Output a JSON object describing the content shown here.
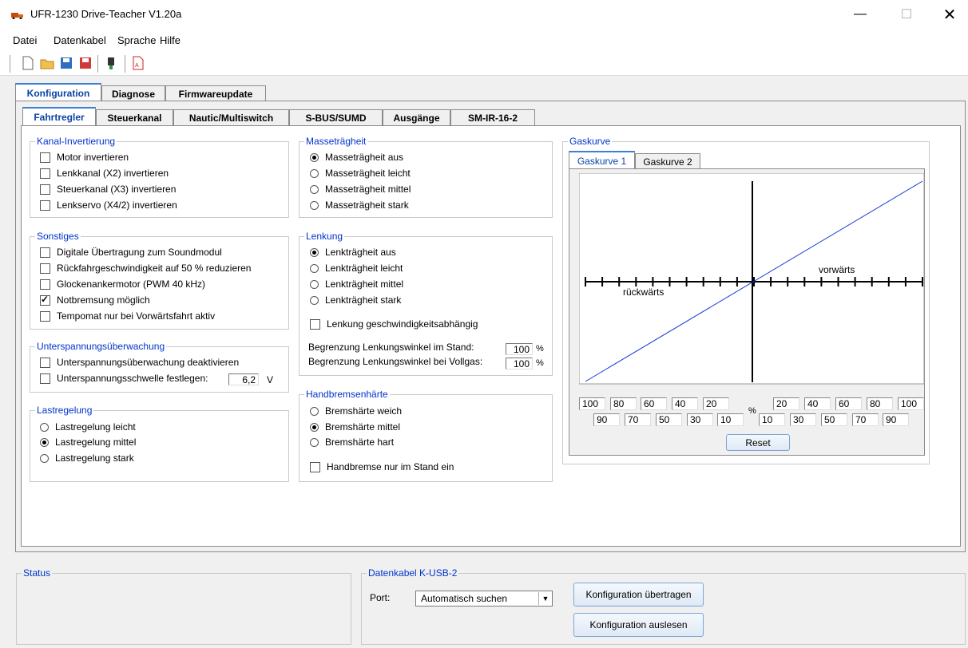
{
  "window": {
    "title": "UFR-1230 Drive-Teacher V1.20a"
  },
  "menu": {
    "datei": "Datei",
    "datenkabel": "Datenkabel",
    "sprache": "Sprache",
    "hilfe": "Hilfe"
  },
  "main_tabs": [
    "Konfiguration",
    "Diagnose",
    "Firmwareupdate"
  ],
  "sub_tabs": [
    "Fahrtregler",
    "Steuerkanal",
    "Nautic/Multiswitch",
    "S-BUS/SUMD",
    "Ausgänge",
    "SM-IR-16-2"
  ],
  "kanal": {
    "title": "Kanal-Invertierung",
    "items": [
      "Motor invertieren",
      "Lenkkanal (X2) invertieren",
      "Steuerkanal (X3) invertieren",
      "Lenkservo (X4/2) invertieren"
    ]
  },
  "sonstiges": {
    "title": "Sonstiges",
    "items": [
      "Digitale Übertragung zum Soundmodul",
      "Rückfahrgeschwindigkeit auf 50 % reduzieren",
      "Glockenankermotor (PWM 40 kHz)",
      "Notbremsung möglich",
      "Tempomat nur bei Vorwärtsfahrt aktiv"
    ]
  },
  "unterspannung": {
    "title": "Unterspannungsüberwachung",
    "deactivate": "Unterspannungsüberwachung deaktivieren",
    "threshold": "Unterspannungsschwelle festlegen:",
    "value": "6,2",
    "unit": "V"
  },
  "last": {
    "title": "Lastregelung",
    "items": [
      "Lastregelung leicht",
      "Lastregelung mittel",
      "Lastregelung stark"
    ]
  },
  "masse": {
    "title": "Masseträgheit",
    "items": [
      "Masseträgheit aus",
      "Masseträgheit leicht",
      "Masseträgheit mittel",
      "Masseträgheit stark"
    ]
  },
  "lenkung": {
    "title": "Lenkung",
    "items": [
      "Lenkträgheit aus",
      "Lenkträgheit leicht",
      "Lenkträgheit mittel",
      "Lenkträgheit stark"
    ],
    "speed_dep": "Lenkung geschwindigkeitsabhängig",
    "limit_stand_label": "Begrenzung Lenkungswinkel im Stand:",
    "limit_stand_value": "100",
    "limit_full_label": "Begrenzung Lenkungswinkel bei Vollgas:",
    "limit_full_value": "100",
    "pct": "%"
  },
  "handbremse": {
    "title": "Handbremsenhärte",
    "items": [
      "Bremshärte weich",
      "Bremshärte mittel",
      "Bremshärte hart"
    ],
    "stand": "Handbremse nur im Stand ein"
  },
  "gaskurve": {
    "title": "Gaskurve",
    "tabs": [
      "Gaskurve 1",
      "Gaskurve 2"
    ],
    "forward_label": "vorwärts",
    "reverse_label": "rückwärts",
    "left_top": [
      "100",
      "80",
      "60",
      "40",
      "20"
    ],
    "left_bottom": [
      "90",
      "70",
      "50",
      "30",
      "10"
    ],
    "right_top": [
      "20",
      "40",
      "60",
      "80",
      "100"
    ],
    "right_bottom": [
      "10",
      "30",
      "50",
      "70",
      "90"
    ],
    "pct": "%",
    "reset": "Reset"
  },
  "status": {
    "title": "Status"
  },
  "kabel": {
    "title": "Datenkabel K-USB-2",
    "port_label": "Port:",
    "port_value": "Automatisch suchen",
    "send": "Konfiguration übertragen",
    "read": "Konfiguration auslesen"
  }
}
